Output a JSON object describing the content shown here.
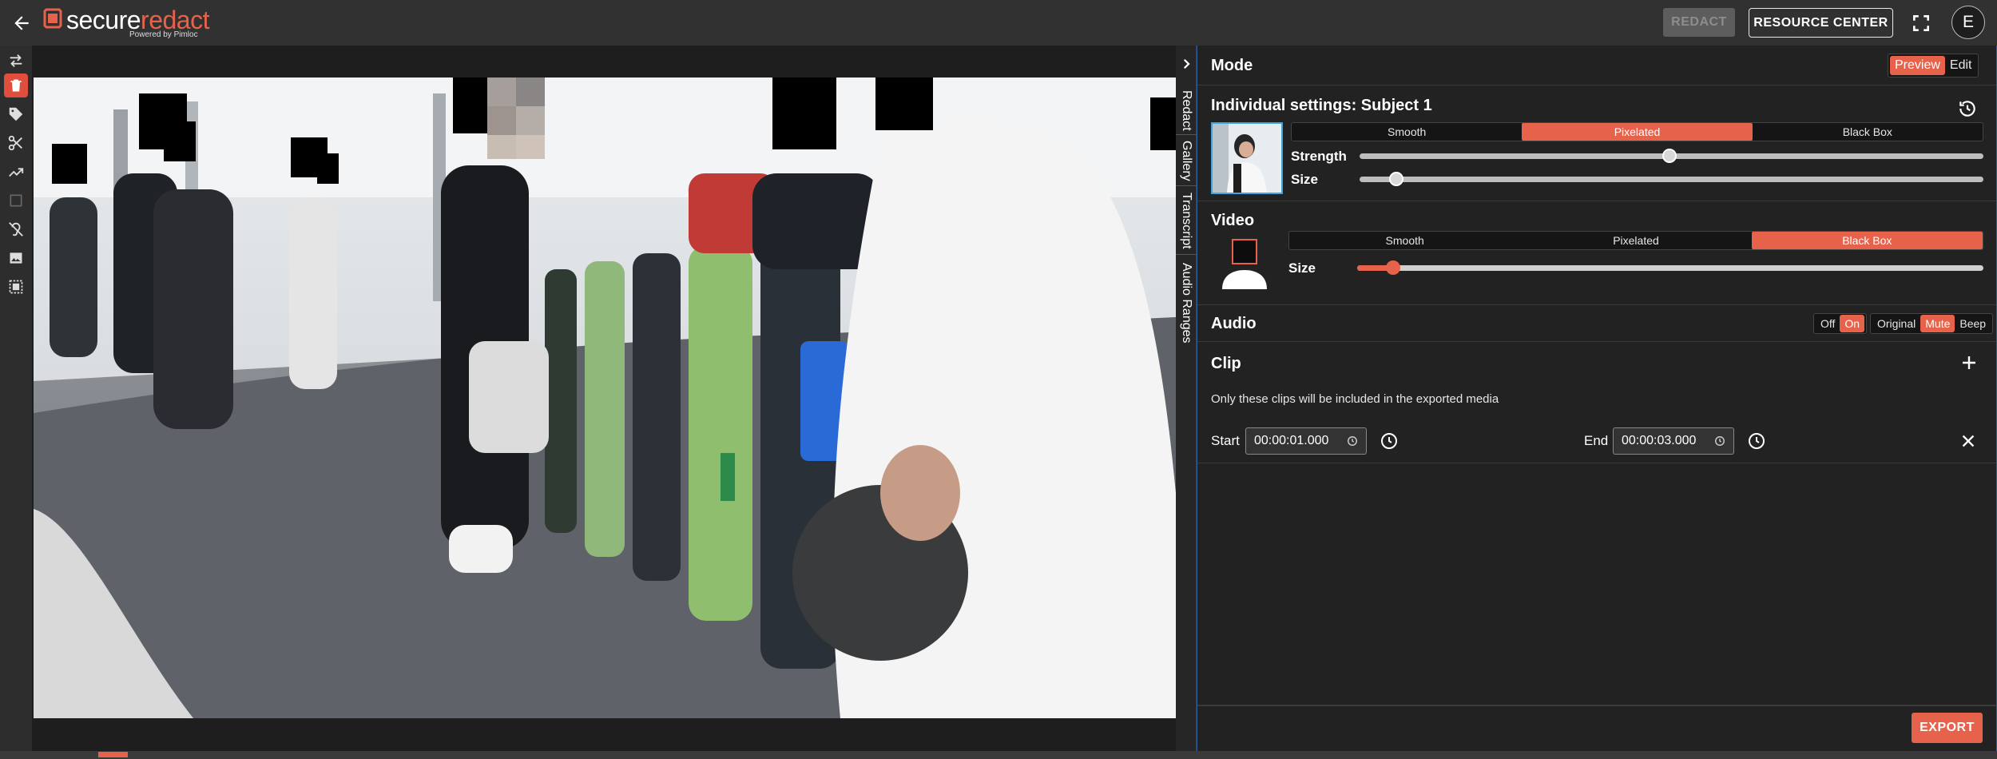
{
  "header": {
    "logo_word_1": "secure",
    "logo_word_2": "redact",
    "logo_sub": "Powered by Pimloc",
    "redact_label": "REDACT",
    "resource_center_label": "RESOURCE CENTER",
    "avatar_initial": "E",
    "icons": [
      "back-arrow-icon",
      "fullscreen-icon"
    ]
  },
  "toolbar": {
    "tools": [
      "swap-icon",
      "trash-icon",
      "tag-icon",
      "scissors-icon",
      "trend-icon",
      "select-box-icon",
      "ear-off-icon",
      "image-icon",
      "frame-icon"
    ],
    "active": "trash-icon"
  },
  "side_tabs": {
    "collapse_icon": "chevron-right-icon",
    "tabs": [
      "Redact",
      "Gallery",
      "Transcript",
      "Audio Ranges"
    ]
  },
  "mode": {
    "title": "Mode",
    "options": [
      "Preview",
      "Edit"
    ],
    "selected": "Preview"
  },
  "individual": {
    "title": "Individual settings: Subject 1",
    "reset_icon": "history-icon",
    "options": [
      "Smooth",
      "Pixelated",
      "Black Box"
    ],
    "selected": "Pixelated",
    "strength_label": "Strength",
    "strength_level": 0.5,
    "size_label": "Size",
    "size_level": 0.06
  },
  "video": {
    "title": "Video",
    "options": [
      "Smooth",
      "Pixelated",
      "Black Box"
    ],
    "selected": "Black Box",
    "size_label": "Size",
    "size_level": 0.06
  },
  "audio": {
    "title": "Audio",
    "toggle_options": [
      "Off",
      "On"
    ],
    "toggle_selected": "On",
    "mode_options": [
      "Original",
      "Mute",
      "Beep"
    ],
    "mode_selected": "Mute"
  },
  "clip": {
    "title": "Clip",
    "description": "Only these clips will be included in the exported media",
    "start_label": "Start",
    "start_value": "00:00:01.000",
    "end_label": "End",
    "end_value": "00:00:03.000"
  },
  "footer": {
    "export_label": "EXPORT"
  },
  "colors": {
    "accent": "#e7624b",
    "panel_bg": "#222222",
    "topbar_bg": "#313131",
    "border_blue": "#2e5f9a"
  }
}
